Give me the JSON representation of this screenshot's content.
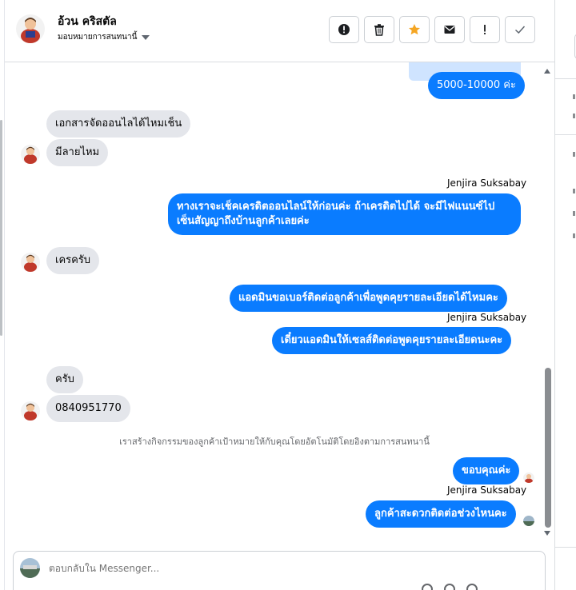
{
  "contact": {
    "name": "อ้วน คริสตัล",
    "assignment": "มอบหมายการสนทนานี้"
  },
  "toolbar": {
    "buttons": [
      {
        "name": "spam-button",
        "icon": "alert-circle-icon"
      },
      {
        "name": "delete-button",
        "icon": "trash-icon"
      },
      {
        "name": "star-button",
        "icon": "star-icon"
      },
      {
        "name": "mark-unread-button",
        "icon": "envelope-icon"
      },
      {
        "name": "follow-up-button",
        "icon": "exclamation-icon"
      },
      {
        "name": "mark-done-button",
        "icon": "checkmark-icon"
      }
    ],
    "accent": "#f5a623"
  },
  "messages": {
    "clipped_top": "...",
    "m1": "5000-10000 ค่ะ",
    "m2": "เอกสารจัดออนไลได้ไหมเช็น",
    "m3": "มีลายไหม",
    "sender": "Jenjira Suksabay",
    "m4_line1": "ทางเราจะเช็คเครดิตออนไลน์ให้ก่อนค่ะ ถ้าเครดิตไปได้ จะมีไฟแนนซ์ไป",
    "m4_line2": "เซ็นสัญญาถึงบ้านลูกค้าเลยค่ะ",
    "m5": "เครครับ",
    "m6": "แอดมินขอเบอร์ติดต่อลูกค้าเพื่อพูดคุยรายละเอียดได้ไหมคะ",
    "m7": "เดี๋ยวแอดมินให้เซลส์ติดต่อพูดคุยรายละเอียดนะคะ",
    "m8": "ครับ",
    "m9": "0840951770",
    "system_note": "เราสร้างกิจกรรมของลูกค้าเป้าหมายให้กับคุณโดยอัตโนมัติโดยอิงตามการสนทนานี้",
    "m10": "ขอบคุณค่ะ",
    "m11": "ลูกค้าสะดวกติดต่อช่วงไหนคะ"
  },
  "composer": {
    "placeholder": "ตอบกลับใน Messenger..."
  },
  "colors": {
    "outgoing": "#0a7cff",
    "incoming": "#e4e6eb"
  }
}
